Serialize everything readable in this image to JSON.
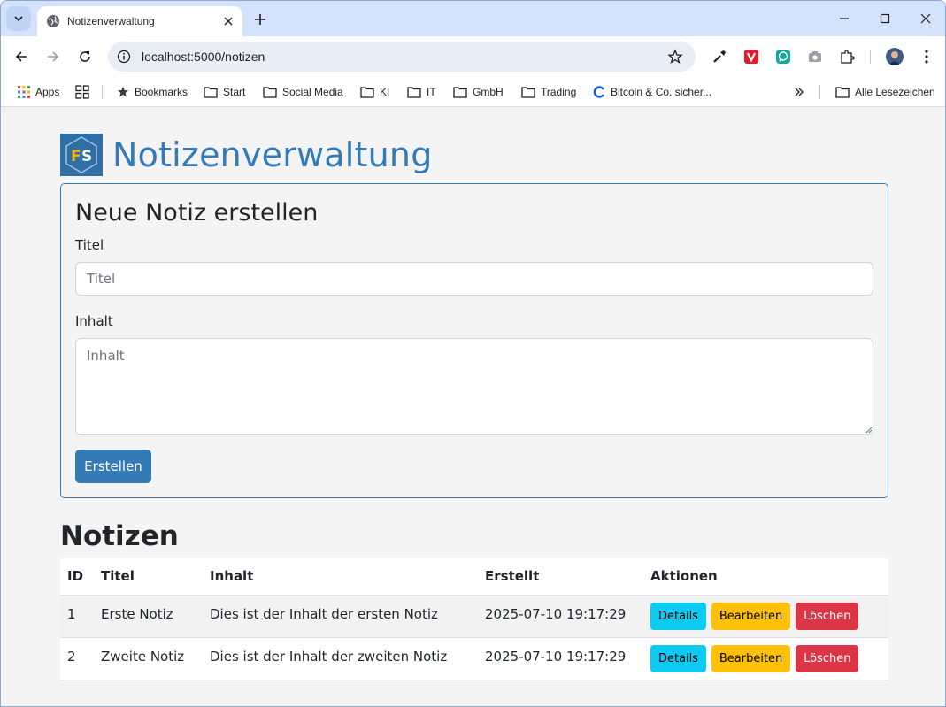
{
  "browser": {
    "tab_title": "Notizenverwaltung",
    "url": "localhost:5000/notizen",
    "bookmarks": [
      {
        "label": "Apps",
        "icon": "apps-grid-icon"
      },
      {
        "label": "",
        "icon": "tab-groups-icon"
      },
      {
        "label": "Bookmarks",
        "icon": "star-icon"
      },
      {
        "label": "Start",
        "icon": "folder-icon"
      },
      {
        "label": "Social Media",
        "icon": "folder-icon"
      },
      {
        "label": "KI",
        "icon": "folder-icon"
      },
      {
        "label": "IT",
        "icon": "folder-icon"
      },
      {
        "label": "GmbH",
        "icon": "folder-icon"
      },
      {
        "label": "Trading",
        "icon": "folder-icon"
      },
      {
        "label": "Bitcoin & Co. sicher...",
        "icon": "bitcoin-site-icon"
      }
    ],
    "all_bookmarks_label": "Alle Lesezeichen",
    "colors": {
      "tabstrip": "#d3e3fd",
      "omnibox": "#e9eef6"
    }
  },
  "page": {
    "logo_text": "FS",
    "title": "Notizenverwaltung",
    "form": {
      "heading": "Neue Notiz erstellen",
      "title_label": "Titel",
      "title_placeholder": "Titel",
      "content_label": "Inhalt",
      "content_placeholder": "Inhalt",
      "submit_label": "Erstellen"
    },
    "notes_heading": "Notizen",
    "table": {
      "headers": [
        "ID",
        "Titel",
        "Inhalt",
        "Erstellt",
        "Aktionen"
      ],
      "rows": [
        {
          "id": "1",
          "title": "Erste Notiz",
          "content": "Dies ist der Inhalt der ersten Notiz",
          "created": "2025-07-10 19:17:29"
        },
        {
          "id": "2",
          "title": "Zweite Notiz",
          "content": "Dies ist der Inhalt der zweiten Notiz",
          "created": "2025-07-10 19:17:29"
        }
      ],
      "actions": {
        "details": "Details",
        "edit": "Bearbeiten",
        "delete": "Löschen"
      }
    },
    "colors": {
      "primary": "#337ab7",
      "info": "#0dcaf0",
      "warning": "#ffc107",
      "danger": "#dc3545"
    }
  }
}
